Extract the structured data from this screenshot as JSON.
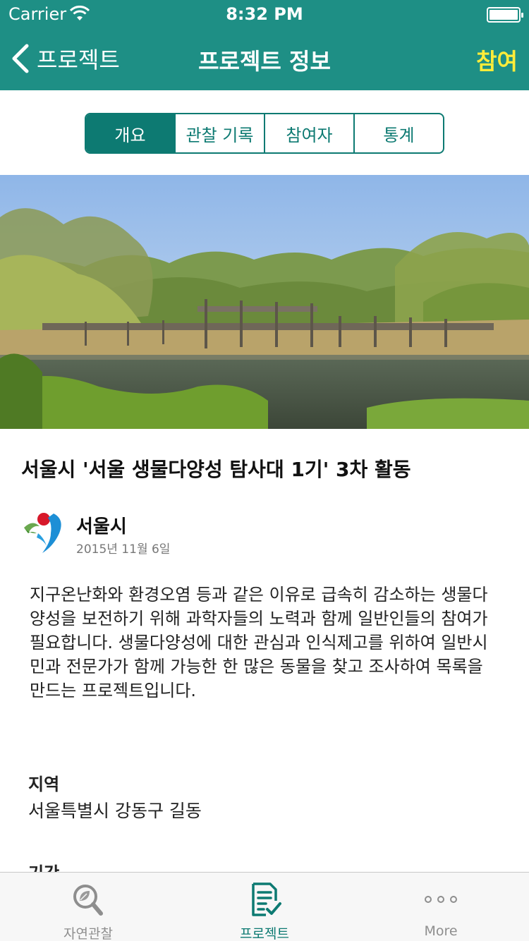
{
  "status_bar": {
    "carrier": "Carrier",
    "time": "8:32 PM"
  },
  "nav": {
    "back_label": "프로젝트",
    "title": "프로젝트 정보",
    "action_label": "참여"
  },
  "segments": [
    {
      "label": "개요",
      "active": true
    },
    {
      "label": "관찰 기록",
      "active": false
    },
    {
      "label": "참여자",
      "active": false
    },
    {
      "label": "통계",
      "active": false
    }
  ],
  "project": {
    "title": "서울시 '서울 생물다양성 탐사대 1기' 3차 활동",
    "organizer": "서울시",
    "date": "2015년 11월 6일",
    "description": "지구온난화와 환경오염 등과 같은 이유로 급속히 감소하는 생물다양성을 보전하기 위해 과학자들의 노력과 함께 일반인들의 참여가 필요합니다. 생물다양성에 대한 관심과 인식제고를 위하여 일반시민과 전문가가 함께 가능한 한 많은 동물을 찾고 조사하여 목록을 만드는 프로젝트입니다.",
    "region_label": "지역",
    "region_value": "서울특별시 강동구 길동",
    "period_label": "기간"
  },
  "tabs": [
    {
      "label": "자연관찰",
      "icon": "magnifier-leaf-icon",
      "active": false
    },
    {
      "label": "프로젝트",
      "icon": "document-check-icon",
      "active": true
    },
    {
      "label": "More",
      "icon": "more-dots-icon",
      "active": false
    }
  ],
  "colors": {
    "header": "#1e8f85",
    "accent": "#0d7a72",
    "action": "#ffec3a"
  }
}
